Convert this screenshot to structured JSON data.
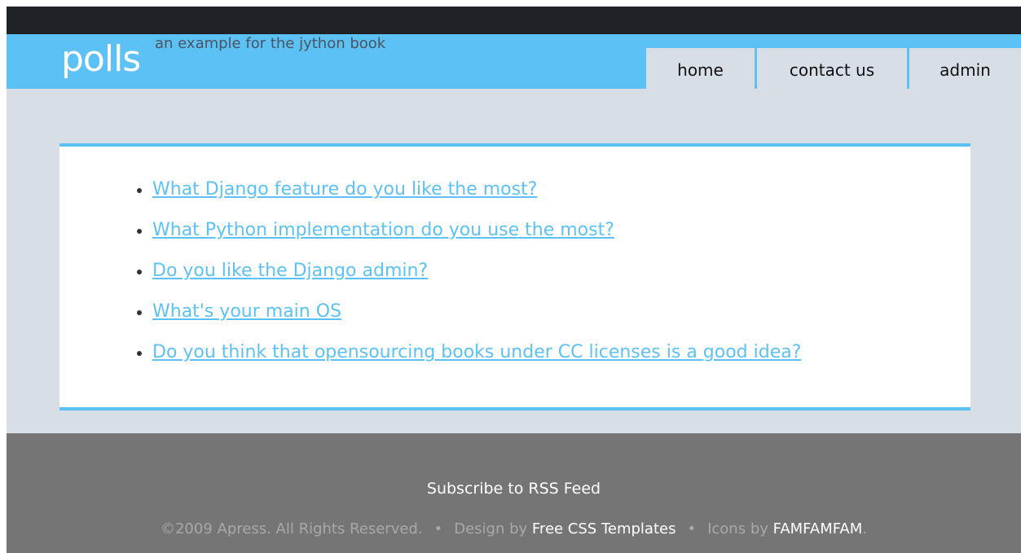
{
  "site": {
    "title": "polls",
    "tagline": "an example for the jython book"
  },
  "nav": {
    "items": [
      {
        "label": "home"
      },
      {
        "label": "contact us"
      },
      {
        "label": "admin"
      }
    ]
  },
  "polls": [
    {
      "question": "What Django feature do you like the most?"
    },
    {
      "question": "What Python implementation do you use the most?"
    },
    {
      "question": "Do you like the Django admin?"
    },
    {
      "question": "What's your main OS"
    },
    {
      "question": "Do you think that opensourcing books under CC licenses is a good idea?"
    }
  ],
  "footer": {
    "rss_label": "Subscribe to RSS Feed",
    "copyright": "©2009 Apress. All Rights Reserved.",
    "separator": "•",
    "design_prefix": "Design by",
    "design_link": "Free CSS Templates",
    "icons_prefix": "Icons by",
    "icons_link": "FAMFAMFAM",
    "icons_suffix": "."
  },
  "colors": {
    "accent": "#5cc1f5",
    "topbar": "#1e2227",
    "page_bg": "#d8dee6",
    "footer_bg": "#757575"
  }
}
